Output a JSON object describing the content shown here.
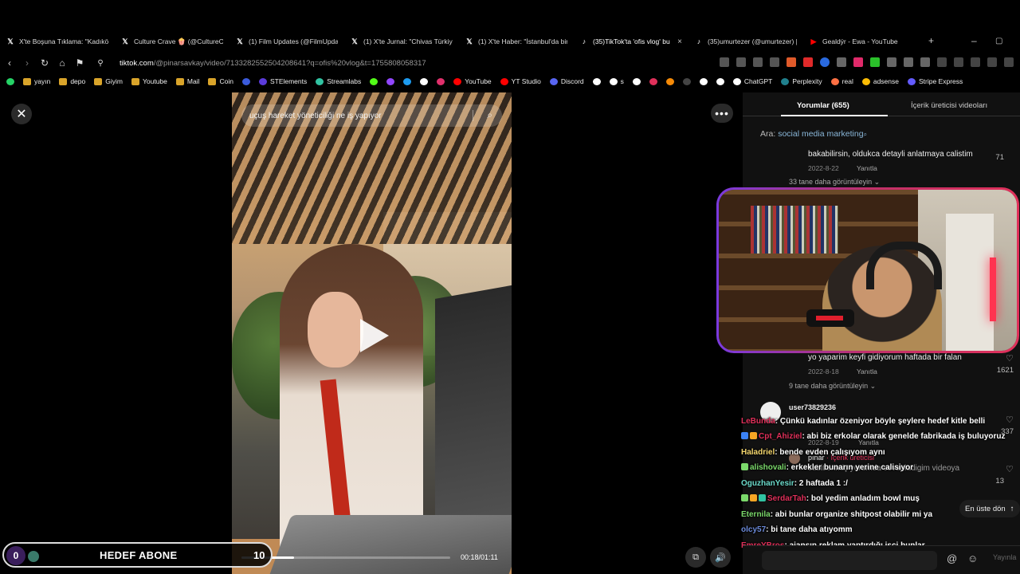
{
  "tabs": [
    {
      "title": "X'te Boşuna Tıklama: \"Kadıköy",
      "icon": "x-logo-icon",
      "color": "#ffffff"
    },
    {
      "title": "Culture Crave 🍿 (@CultureCra",
      "icon": "x-logo-icon",
      "color": "#ffffff"
    },
    {
      "title": "(1) Film Updates (@FilmUpdat",
      "icon": "x-logo-icon",
      "color": "#ffffff"
    },
    {
      "title": "(1) X'te Jurnal: \"Chivas Türkiye",
      "icon": "x-logo-icon",
      "color": "#ffffff"
    },
    {
      "title": "(1) X'te Haber: \"İstanbul'da bir",
      "icon": "x-logo-icon",
      "color": "#ffffff"
    },
    {
      "title": "(35)TikTok'ta 'ofis vlog' bu",
      "icon": "tiktok-icon",
      "color": "#ffffff",
      "active": true
    },
    {
      "title": "(35)umurtezer (@umurtezer) |",
      "icon": "tiktok-icon",
      "color": "#ffffff"
    },
    {
      "title": "Gealdýr - Ewa - YouTube",
      "icon": "youtube-icon",
      "color": "#ff0000"
    }
  ],
  "address": {
    "domain": "tiktok.com",
    "path": "/@pinarsavkay/video/7133282552504208641?q=ofis%20vlog&t=1755808058317"
  },
  "bookmarks": [
    {
      "label": "yayın",
      "type": "folder"
    },
    {
      "label": "depo",
      "type": "folder"
    },
    {
      "label": "Giyim",
      "type": "folder"
    },
    {
      "label": "Youtube",
      "type": "folder"
    },
    {
      "label": "Mail",
      "type": "folder"
    },
    {
      "label": "Coin",
      "type": "folder"
    },
    {
      "label": "",
      "type": "icon",
      "color": "#3b5bdb"
    },
    {
      "label": "STElements",
      "type": "icon",
      "color": "#5b3bdb"
    },
    {
      "label": "Streamlabs",
      "type": "icon",
      "color": "#31c3a2"
    },
    {
      "label": "",
      "type": "icon",
      "color": "#53fc18"
    },
    {
      "label": "",
      "type": "icon",
      "color": "#9146ff"
    },
    {
      "label": "",
      "type": "icon",
      "color": "#1d9bf0"
    },
    {
      "label": "",
      "type": "icon",
      "color": "#ffffff"
    },
    {
      "label": "",
      "type": "icon",
      "color": "#e1306c"
    },
    {
      "label": "YouTube",
      "type": "icon",
      "color": "#ff0000"
    },
    {
      "label": "YT Studio",
      "type": "icon",
      "color": "#ff0000"
    },
    {
      "label": "Discord",
      "type": "icon",
      "color": "#5865f2"
    },
    {
      "label": "",
      "type": "icon",
      "color": "#ffffff"
    },
    {
      "label": "s",
      "type": "icon",
      "color": "#ffffff"
    },
    {
      "label": "",
      "type": "icon",
      "color": "#ffffff"
    },
    {
      "label": "",
      "type": "icon",
      "color": "#e0305a"
    },
    {
      "label": "",
      "type": "icon",
      "color": "#f58a07"
    },
    {
      "label": "",
      "type": "icon",
      "color": "#444444"
    },
    {
      "label": "",
      "type": "icon",
      "color": "#ffffff"
    },
    {
      "label": "",
      "type": "icon",
      "color": "#ffffff"
    },
    {
      "label": "ChatGPT",
      "type": "icon",
      "color": "#ffffff"
    },
    {
      "label": "Perplexity",
      "type": "icon",
      "color": "#20808d"
    },
    {
      "label": "real",
      "type": "icon",
      "color": "#ff7043"
    },
    {
      "label": "adsense",
      "type": "icon",
      "color": "#fbbc04"
    },
    {
      "label": "Stripe Express",
      "type": "icon",
      "color": "#635bff"
    }
  ],
  "video": {
    "search_text": "uçuş hareket yöneticiliği ne iş yapıyor",
    "time": "00:18/01:11",
    "progress": 0.25
  },
  "hedef": {
    "count": "0",
    "label": "HEDEF ABONE",
    "goal": "10"
  },
  "panel": {
    "tab_comments": "Yorumlar (655)",
    "tab_creator": "İçerik üreticisi videoları",
    "search_prefix": "Ara:",
    "search_term": "social media marketing",
    "top_button": "En üste dön",
    "post_label": "Yayınla"
  },
  "comments": [
    {
      "text": "bakabilirsin, oldukca detayli anlatmaya calistim",
      "date": "2022-8-22",
      "reply": "Yanıtla",
      "likes": "71",
      "more": "33 tane daha görüntüleyin ⌄"
    },
    {
      "text": "yo yaparim keyfi gidiyorum haftada bir falan",
      "date": "2022-8-18",
      "reply": "Yanıtla",
      "likes": "1621",
      "more": "9 tane daha görüntüleyin ⌄"
    },
    {
      "user": "user73829236",
      "likes": "337",
      "date": "2022-8-19",
      "reply": "Yanıtla"
    },
    {
      "user": "pınar",
      "creator": "· İçerik üreticisi",
      "text": "sabitlenmiş yorumda cevapladigim videoya",
      "likes": "13"
    }
  ],
  "chat": [
    {
      "user": "LeBunda",
      "color": "#e0305a",
      "msg": ": Çünkü kadınlar özeniyor böyle şeylere hedef kitle belli"
    },
    {
      "user": "Cpt_Ahiziel",
      "color": "#e0305a",
      "msg": ": abi biz erkolar olarak genelde fabrikada iş buluyoruz",
      "badges": [
        "#3b82f6",
        "#f5a524"
      ],
      "wrap": true
    },
    {
      "user": "Haladriel",
      "color": "#f5d76e",
      "msg": ": bende evden çalışıyom aynı"
    },
    {
      "user": "alishovali",
      "color": "#7bd96b",
      "msg": ": erkekler bunarın yerine calisiyor",
      "badges": [
        "#7bd96b"
      ]
    },
    {
      "user": "OguzhanYesir",
      "color": "#6bd9c9",
      "msg": ": 2 haftada 1 :/"
    },
    {
      "user": "SerdarTah",
      "color": "#e0305a",
      "msg": ": bol yedim anladım bowl muş",
      "badges": [
        "#7bd96b",
        "#f5a524",
        "#31c3a2"
      ]
    },
    {
      "user": "Eternila",
      "color": "#7bd96b",
      "msg": ": abi bunlar organize shitpost olabilir mi ya"
    },
    {
      "user": "olcy57",
      "color": "#6b8ad9",
      "msg": ": bi tane daha atıyomm"
    },
    {
      "user": "EmreYBros",
      "color": "#e0305a",
      "msg": ": ajansın reklam yaptırdığı işçi bunlar"
    }
  ]
}
